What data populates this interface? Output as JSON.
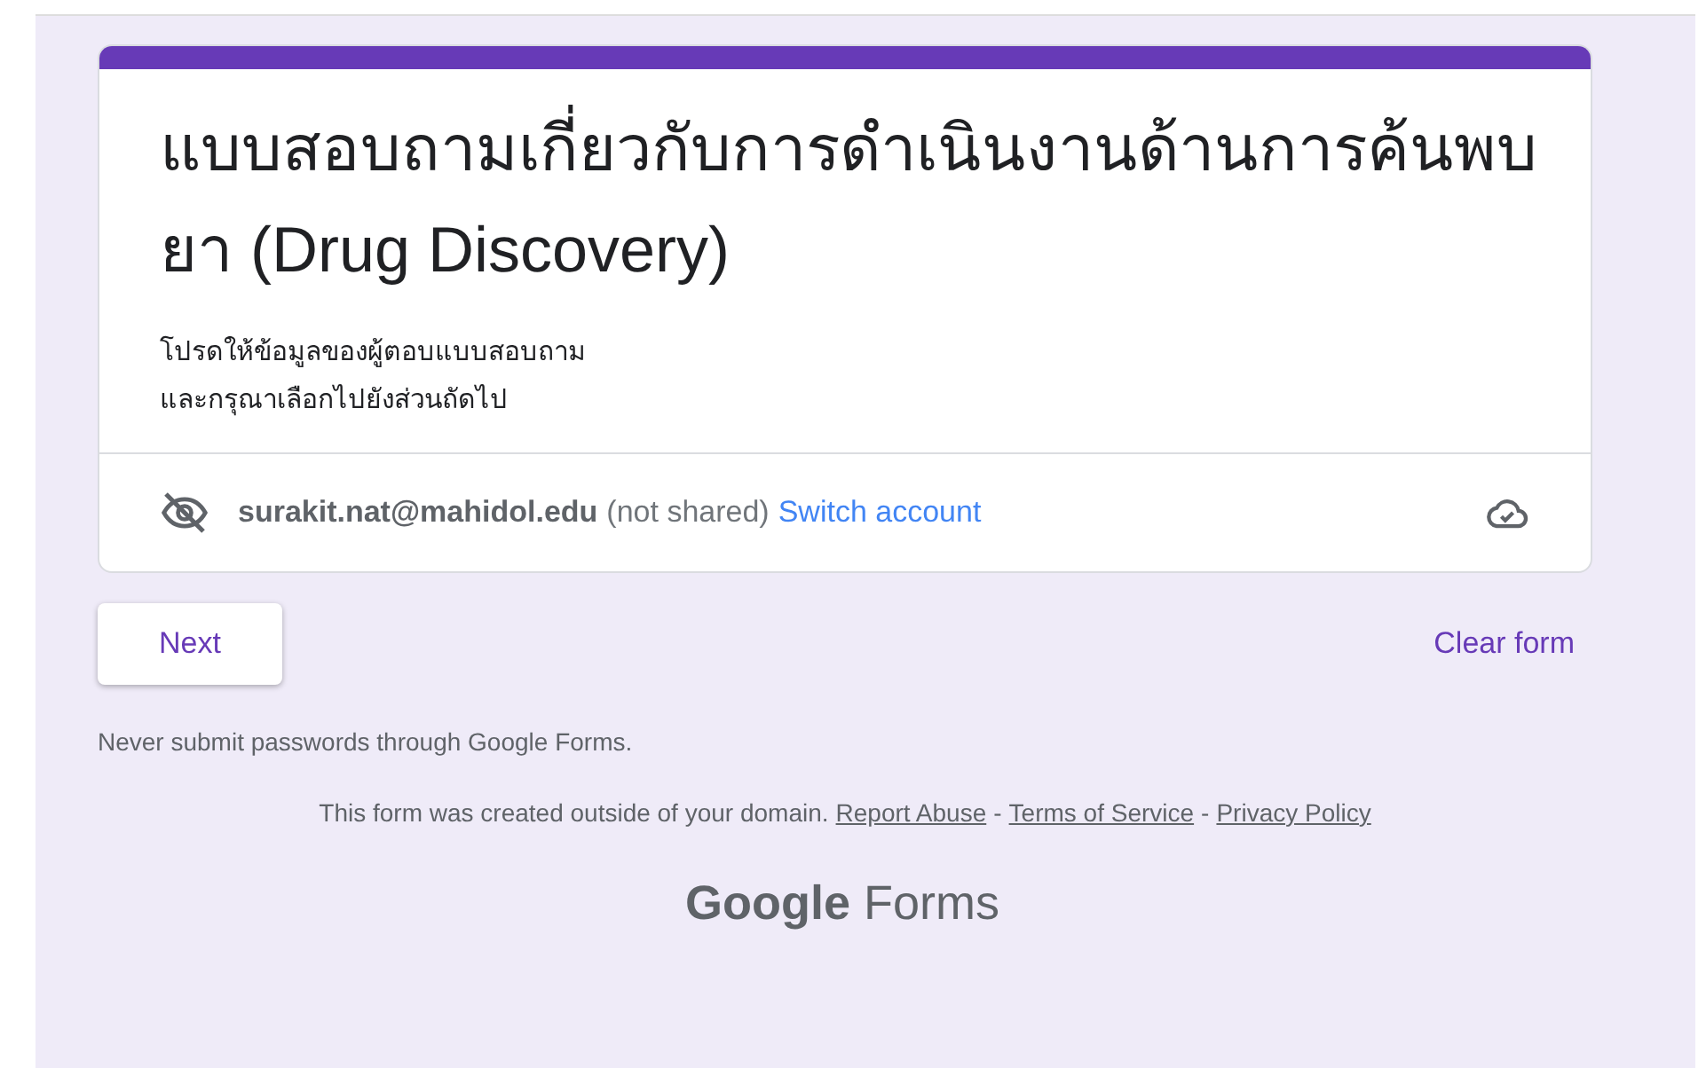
{
  "form": {
    "title": "แบบสอบถามเกี่ยวกับการดำเนินงานด้านการค้นพบยา (Drug Discovery)",
    "description": [
      "โปรดให้ข้อมูลของผู้ตอบแบบสอบถาม",
      "และกรุณาเลือกไปยังส่วนถัดไป"
    ],
    "account": {
      "email": "surakit.nat@mahidol.edu",
      "note": "(not shared)",
      "switch_link": "Switch account"
    }
  },
  "buttons": {
    "next": "Next",
    "clear": "Clear form"
  },
  "warning": "Never submit passwords through Google Forms.",
  "footer": {
    "notice": "This form was created outside of your domain.",
    "links": [
      "Report Abuse",
      "Terms of Service",
      "Privacy Policy"
    ],
    "separator": "-"
  },
  "logo": {
    "brand": "Google",
    "product": "Forms"
  }
}
